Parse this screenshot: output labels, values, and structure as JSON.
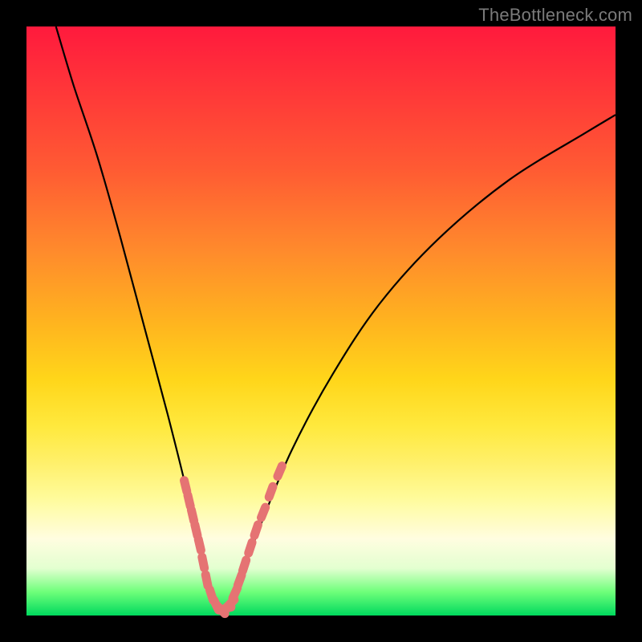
{
  "watermark": "TheBottleneck.com",
  "colors": {
    "frame": "#000000",
    "curve_stroke": "#000000",
    "marker_fill": "#e57373",
    "marker_stroke": "#d46a6a"
  },
  "chart_data": {
    "type": "line",
    "title": "",
    "xlabel": "",
    "ylabel": "",
    "xlim": [
      0,
      100
    ],
    "ylim": [
      0,
      100
    ],
    "grid": false,
    "series": [
      {
        "name": "bottleneck-curve",
        "x": [
          5,
          8,
          12,
          16,
          20,
          24,
          27,
          29,
          30.5,
          32,
          33.5,
          35,
          37,
          40,
          45,
          52,
          60,
          70,
          82,
          95,
          100
        ],
        "y": [
          100,
          90,
          78,
          64,
          49,
          34,
          22,
          13,
          7,
          3,
          1,
          3,
          8,
          16,
          28,
          41,
          53,
          64,
          74,
          82,
          85
        ]
      }
    ],
    "markers": {
      "name": "highlight-beads",
      "points": [
        {
          "x": 27.0,
          "y": 22.0
        },
        {
          "x": 27.6,
          "y": 19.5
        },
        {
          "x": 28.2,
          "y": 17.0
        },
        {
          "x": 28.8,
          "y": 14.5
        },
        {
          "x": 29.4,
          "y": 12.0
        },
        {
          "x": 30.0,
          "y": 9.0
        },
        {
          "x": 30.6,
          "y": 6.0
        },
        {
          "x": 31.4,
          "y": 3.5
        },
        {
          "x": 32.2,
          "y": 1.8
        },
        {
          "x": 33.0,
          "y": 1.0
        },
        {
          "x": 33.8,
          "y": 1.2
        },
        {
          "x": 34.6,
          "y": 2.0
        },
        {
          "x": 35.4,
          "y": 3.8
        },
        {
          "x": 36.2,
          "y": 6.0
        },
        {
          "x": 37.0,
          "y": 8.5
        },
        {
          "x": 38.0,
          "y": 11.5
        },
        {
          "x": 39.0,
          "y": 14.5
        },
        {
          "x": 40.2,
          "y": 17.5
        },
        {
          "x": 41.5,
          "y": 21.0
        },
        {
          "x": 43.0,
          "y": 24.5
        }
      ]
    }
  }
}
